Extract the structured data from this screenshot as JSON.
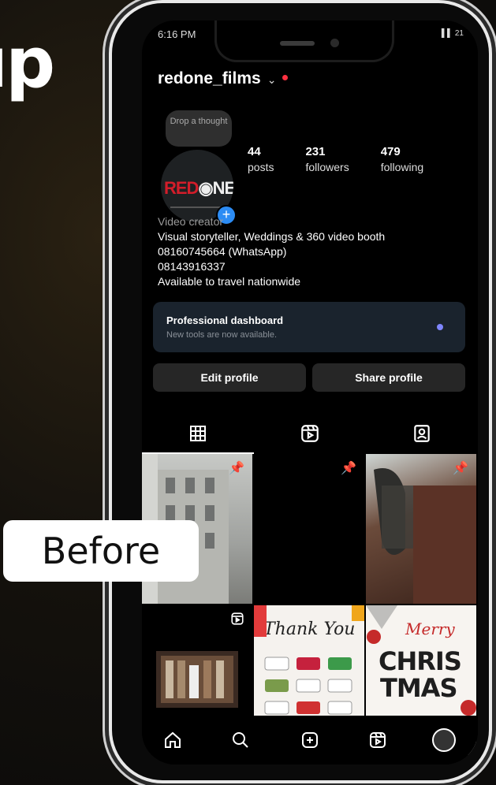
{
  "side_text": "ıp",
  "before_label": "Before",
  "status_bar": {
    "time": "6:16 PM",
    "icons": "▌▌ 21"
  },
  "profile": {
    "username": "redone_films",
    "avatar_logo_left": "RED",
    "avatar_logo_right": "NE",
    "note_bubble": "Drop a thought",
    "stats": {
      "posts": {
        "value": "44",
        "label": "posts"
      },
      "followers": {
        "value": "231",
        "label": "followers"
      },
      "following": {
        "value": "479",
        "label": "following"
      }
    },
    "bio": {
      "category": "Video creator",
      "lines": [
        "Visual storyteller,  Weddings & 360 video booth",
        "08160745664 (WhatsApp)",
        "08143916337",
        "Available to travel nationwide"
      ]
    }
  },
  "pro_dashboard": {
    "title": "Professional dashboard",
    "subtitle": "New tools are now available."
  },
  "buttons": {
    "edit": "Edit profile",
    "share": "Share profile"
  },
  "grid_posts": [
    {
      "name": "building",
      "pinned": true
    },
    {
      "name": "black",
      "pinned": true
    },
    {
      "name": "ornament",
      "pinned": true
    },
    {
      "name": "studio-reel",
      "pinned": false
    },
    {
      "name": "thank-you",
      "pinned": false,
      "text": "Thank You"
    },
    {
      "name": "christmas",
      "pinned": false,
      "text1": "Merry",
      "text2": "CHRIS",
      "text3": "TMAS"
    }
  ],
  "colors": {
    "accent": "#2c8cf4",
    "brand_red": "#d31d2a",
    "notif_dot": "#ff3040"
  }
}
